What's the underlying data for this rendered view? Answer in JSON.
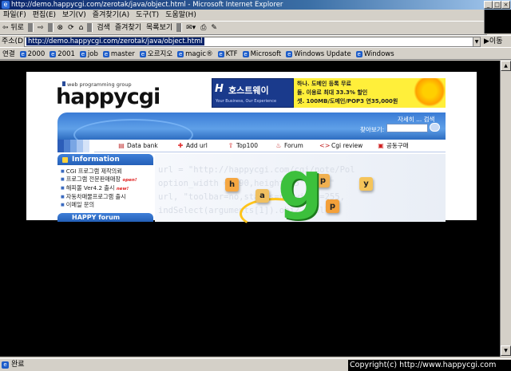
{
  "window": {
    "title": "http://demo.happycgi.com/zerotak/java/object.html - Microsoft Internet Explorer",
    "min": "_",
    "max": "□",
    "close": "×"
  },
  "menu": [
    "파일(F)",
    "편집(E)",
    "보기(V)",
    "즐겨찾기(A)",
    "도구(T)",
    "도움말(H)"
  ],
  "toolbar": {
    "back": "⇦ 뒤로",
    "forward": "⇨",
    "stop": "⊗",
    "refresh": "⟳",
    "home": "⌂",
    "search": "검색",
    "favorites": "즐겨찾기",
    "history": "목록보기"
  },
  "address": {
    "label": "주소(D)",
    "value": "http://demo.happycgi.com/zerotak/java/object.html",
    "go": "이동"
  },
  "links": {
    "label": "연결",
    "items": [
      "2000",
      "2001",
      "job",
      "master",
      "오르지오",
      "magic®",
      "KTF",
      "Microsoft",
      "Windows Update",
      "Windows"
    ]
  },
  "site": {
    "logo_sub": "web programming group",
    "logo": "happycgi",
    "banner1": {
      "icon": "H",
      "title": "호스트웨이",
      "sub": "Your Business, Our Experience"
    },
    "banner2": {
      "line1": "하나. 도메인 등록 무료",
      "line2": "둘. 이용료 최대 33.3% 할인",
      "line3": "셋. 100MB/도메인/POP3 연35,000원"
    },
    "header_links": "자세히 ... 검색",
    "search_label": "찾아보기:",
    "nav": [
      {
        "label": "Data bank",
        "icon": "▤",
        "color": "#c03030"
      },
      {
        "label": "Add url",
        "icon": "✚",
        "color": "#e03030"
      },
      {
        "label": "Top100",
        "icon": "⇧",
        "color": "#d02020"
      },
      {
        "label": "Forum",
        "icon": "♨",
        "color": "#c02020"
      },
      {
        "label": "Cgi review",
        "icon": "<>",
        "color": "#c02020"
      },
      {
        "label": "공동구매",
        "icon": "▣",
        "color": "#d02020"
      }
    ],
    "info_title": "Information",
    "info_items": [
      "CGI 프로그램 제작의뢰",
      "프로그램 전문판매매장",
      "해피몰 Ver4.2 출시",
      "자동차매물프로그램 출시",
      "이메일 문의"
    ],
    "info_badges": {
      "open": "open!",
      "new": "new!"
    },
    "forum_title": "HAPPY forum",
    "code_lines": [
      "url = \"http://happycgi.com/cgi/note/Pol",
      "option_width = 390,height=\"5\",_id=\"",
      "url, \"toolbar=no,status=no,width=255,",
      "indSelect(arguments[1]).obj2, pollie"
    ],
    "cubes": [
      "h",
      "a",
      "p",
      "p",
      "y"
    ],
    "big_letter": "g"
  },
  "status": {
    "text": "완료",
    "copyright": "Copyright(c) http://www.happycgi.com"
  }
}
